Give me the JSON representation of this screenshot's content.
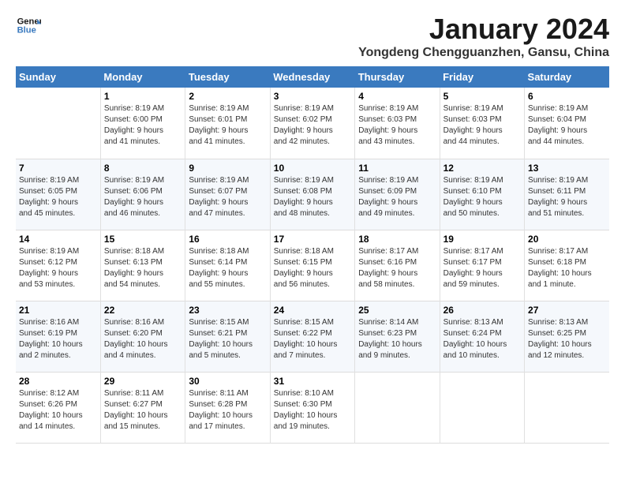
{
  "logo": {
    "line1": "General",
    "line2": "Blue"
  },
  "title": "January 2024",
  "subtitle": "Yongdeng Chengguanzhen, Gansu, China",
  "days_of_week": [
    "Sunday",
    "Monday",
    "Tuesday",
    "Wednesday",
    "Thursday",
    "Friday",
    "Saturday"
  ],
  "weeks": [
    [
      {
        "day": "",
        "info": ""
      },
      {
        "day": "1",
        "info": "Sunrise: 8:19 AM\nSunset: 6:00 PM\nDaylight: 9 hours\nand 41 minutes."
      },
      {
        "day": "2",
        "info": "Sunrise: 8:19 AM\nSunset: 6:01 PM\nDaylight: 9 hours\nand 41 minutes."
      },
      {
        "day": "3",
        "info": "Sunrise: 8:19 AM\nSunset: 6:02 PM\nDaylight: 9 hours\nand 42 minutes."
      },
      {
        "day": "4",
        "info": "Sunrise: 8:19 AM\nSunset: 6:03 PM\nDaylight: 9 hours\nand 43 minutes."
      },
      {
        "day": "5",
        "info": "Sunrise: 8:19 AM\nSunset: 6:03 PM\nDaylight: 9 hours\nand 44 minutes."
      },
      {
        "day": "6",
        "info": "Sunrise: 8:19 AM\nSunset: 6:04 PM\nDaylight: 9 hours\nand 44 minutes."
      }
    ],
    [
      {
        "day": "7",
        "info": "Sunrise: 8:19 AM\nSunset: 6:05 PM\nDaylight: 9 hours\nand 45 minutes."
      },
      {
        "day": "8",
        "info": "Sunrise: 8:19 AM\nSunset: 6:06 PM\nDaylight: 9 hours\nand 46 minutes."
      },
      {
        "day": "9",
        "info": "Sunrise: 8:19 AM\nSunset: 6:07 PM\nDaylight: 9 hours\nand 47 minutes."
      },
      {
        "day": "10",
        "info": "Sunrise: 8:19 AM\nSunset: 6:08 PM\nDaylight: 9 hours\nand 48 minutes."
      },
      {
        "day": "11",
        "info": "Sunrise: 8:19 AM\nSunset: 6:09 PM\nDaylight: 9 hours\nand 49 minutes."
      },
      {
        "day": "12",
        "info": "Sunrise: 8:19 AM\nSunset: 6:10 PM\nDaylight: 9 hours\nand 50 minutes."
      },
      {
        "day": "13",
        "info": "Sunrise: 8:19 AM\nSunset: 6:11 PM\nDaylight: 9 hours\nand 51 minutes."
      }
    ],
    [
      {
        "day": "14",
        "info": "Sunrise: 8:19 AM\nSunset: 6:12 PM\nDaylight: 9 hours\nand 53 minutes."
      },
      {
        "day": "15",
        "info": "Sunrise: 8:18 AM\nSunset: 6:13 PM\nDaylight: 9 hours\nand 54 minutes."
      },
      {
        "day": "16",
        "info": "Sunrise: 8:18 AM\nSunset: 6:14 PM\nDaylight: 9 hours\nand 55 minutes."
      },
      {
        "day": "17",
        "info": "Sunrise: 8:18 AM\nSunset: 6:15 PM\nDaylight: 9 hours\nand 56 minutes."
      },
      {
        "day": "18",
        "info": "Sunrise: 8:17 AM\nSunset: 6:16 PM\nDaylight: 9 hours\nand 58 minutes."
      },
      {
        "day": "19",
        "info": "Sunrise: 8:17 AM\nSunset: 6:17 PM\nDaylight: 9 hours\nand 59 minutes."
      },
      {
        "day": "20",
        "info": "Sunrise: 8:17 AM\nSunset: 6:18 PM\nDaylight: 10 hours\nand 1 minute."
      }
    ],
    [
      {
        "day": "21",
        "info": "Sunrise: 8:16 AM\nSunset: 6:19 PM\nDaylight: 10 hours\nand 2 minutes."
      },
      {
        "day": "22",
        "info": "Sunrise: 8:16 AM\nSunset: 6:20 PM\nDaylight: 10 hours\nand 4 minutes."
      },
      {
        "day": "23",
        "info": "Sunrise: 8:15 AM\nSunset: 6:21 PM\nDaylight: 10 hours\nand 5 minutes."
      },
      {
        "day": "24",
        "info": "Sunrise: 8:15 AM\nSunset: 6:22 PM\nDaylight: 10 hours\nand 7 minutes."
      },
      {
        "day": "25",
        "info": "Sunrise: 8:14 AM\nSunset: 6:23 PM\nDaylight: 10 hours\nand 9 minutes."
      },
      {
        "day": "26",
        "info": "Sunrise: 8:13 AM\nSunset: 6:24 PM\nDaylight: 10 hours\nand 10 minutes."
      },
      {
        "day": "27",
        "info": "Sunrise: 8:13 AM\nSunset: 6:25 PM\nDaylight: 10 hours\nand 12 minutes."
      }
    ],
    [
      {
        "day": "28",
        "info": "Sunrise: 8:12 AM\nSunset: 6:26 PM\nDaylight: 10 hours\nand 14 minutes."
      },
      {
        "day": "29",
        "info": "Sunrise: 8:11 AM\nSunset: 6:27 PM\nDaylight: 10 hours\nand 15 minutes."
      },
      {
        "day": "30",
        "info": "Sunrise: 8:11 AM\nSunset: 6:28 PM\nDaylight: 10 hours\nand 17 minutes."
      },
      {
        "day": "31",
        "info": "Sunrise: 8:10 AM\nSunset: 6:30 PM\nDaylight: 10 hours\nand 19 minutes."
      },
      {
        "day": "",
        "info": ""
      },
      {
        "day": "",
        "info": ""
      },
      {
        "day": "",
        "info": ""
      }
    ]
  ]
}
